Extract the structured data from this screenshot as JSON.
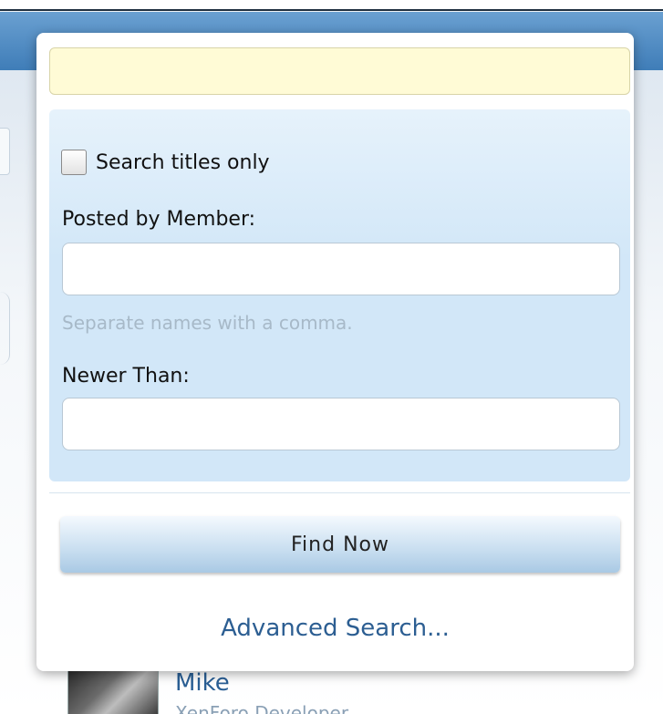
{
  "background": {
    "member": {
      "name": "Mike",
      "title": "XenForo Developer"
    }
  },
  "search_popup": {
    "query_placeholder": "",
    "titles_only_label": "Search titles only",
    "titles_only_checked": false,
    "posted_by_label": "Posted by Member:",
    "posted_by_value": "",
    "posted_by_hint": "Separate names with a comma.",
    "newer_than_label": "Newer Than:",
    "newer_than_value": "",
    "find_button_label": "Find Now",
    "advanced_link_label": "Advanced Search..."
  },
  "colors": {
    "accent": "#3f7db8",
    "link": "#2c5e92",
    "query_bg": "#fffbd6",
    "options_bg": "#d2e7f8"
  }
}
